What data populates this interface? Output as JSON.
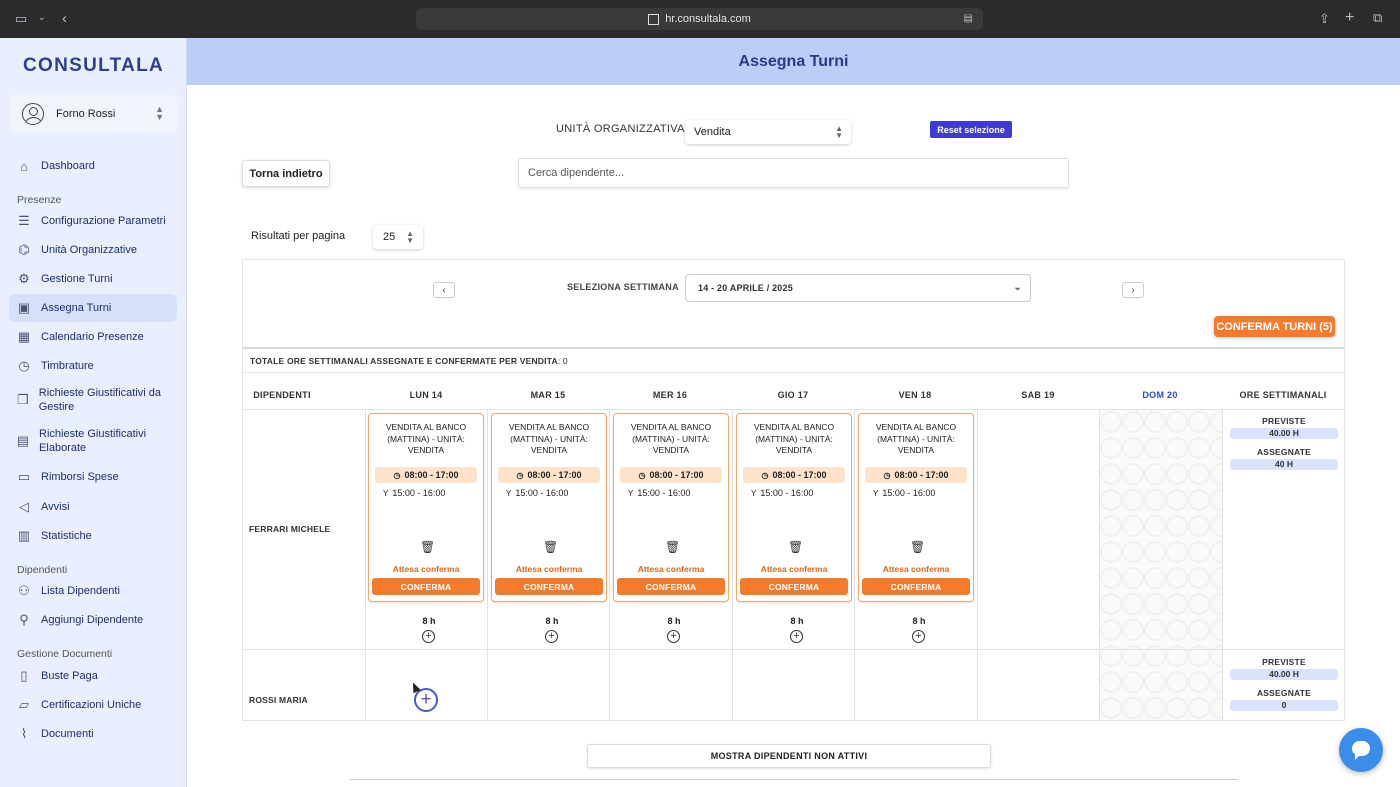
{
  "browser": {
    "url": "hr.consultala.com"
  },
  "sidebar": {
    "logo": "CONSULTALA",
    "company": "Forno Rossi",
    "dashboard": "Dashboard",
    "section_presenze": "Presenze",
    "presenze_items": [
      {
        "label": "Configurazione Parametri",
        "icon": "sliders-icon"
      },
      {
        "label": "Unità Organizzative",
        "icon": "graduation-cap-icon"
      },
      {
        "label": "Gestione Turni",
        "icon": "gear-icon"
      },
      {
        "label": "Assegna Turni",
        "icon": "briefcase-icon"
      },
      {
        "label": "Calendario Presenze",
        "icon": "calendar-icon"
      },
      {
        "label": "Timbrature",
        "icon": "clock-icon"
      },
      {
        "label": "Richieste Giustificativi da Gestire",
        "icon": "documents-icon"
      },
      {
        "label": "Richieste Giustificativi Elaborate",
        "icon": "clipboard-icon"
      },
      {
        "label": "Rimborsi Spese",
        "icon": "wallet-icon"
      },
      {
        "label": "Avvisi",
        "icon": "megaphone-icon"
      },
      {
        "label": "Statistiche",
        "icon": "bar-chart-icon"
      }
    ],
    "section_dipendenti": "Dipendenti",
    "dipendenti_items": [
      {
        "label": "Lista Dipendenti",
        "icon": "users-icon"
      },
      {
        "label": "Aggiungi Dipendente",
        "icon": "user-plus-icon"
      }
    ],
    "section_documenti": "Gestione Documenti",
    "documenti_items": [
      {
        "label": "Buste Paga",
        "icon": "file-icon"
      },
      {
        "label": "Certificazioni Uniche",
        "icon": "folder-icon"
      },
      {
        "label": "Documenti",
        "icon": "paperclip-icon"
      }
    ]
  },
  "header": {
    "title": "Assegna Turni"
  },
  "filters": {
    "ou_label": "UNITÀ ORGANIZZATIVA",
    "ou_value": "Vendita",
    "reset_label": "Reset selezione",
    "back_label": "Torna indietro",
    "search_placeholder": "Cerca dipendente...",
    "rpp_label": "Risultati per pagina",
    "rpp_value": "25"
  },
  "week": {
    "label": "SELEZIONA SETTIMANA",
    "value": "14 - 20 APRILE / 2025",
    "confirm_all": "CONFERMA TURNI (5)",
    "totals_prefix": "TOTALE ORE SETTIMANALI ASSEGNATE E CONFERMATE PER",
    "totals_unit": "VENDITA",
    "totals_value": ": 0"
  },
  "table": {
    "headers": [
      "DIPENDENTI",
      "LUN 14",
      "MAR 15",
      "MER 16",
      "GIO 17",
      "VEN 18",
      "SAB 19",
      "DOM 20",
      "ORE SETTIMANALI"
    ],
    "shift": {
      "name": "VENDITA AL BANCO (MATTINA) - UNITÀ: VENDITA",
      "time": "08:00 - 17:00",
      "break": "15:00 - 16:00",
      "status": "Attesa conferma",
      "confirm": "CONFERMA",
      "hours": "8 h"
    },
    "employees": [
      {
        "name": "FERRARI MICHELE",
        "previste_label": "PREVISTE",
        "previste": "40.00 H",
        "assegnate_label": "ASSEGNATE",
        "assegnate": "40 H"
      },
      {
        "name": "ROSSI MARIA",
        "previste_label": "PREVISTE",
        "previste": "40.00 H",
        "assegnate_label": "ASSEGNATE",
        "assegnate": "0"
      }
    ]
  },
  "footer": {
    "show_inactive": "MOSTRA DIPENDENTI NON ATTIVI"
  }
}
